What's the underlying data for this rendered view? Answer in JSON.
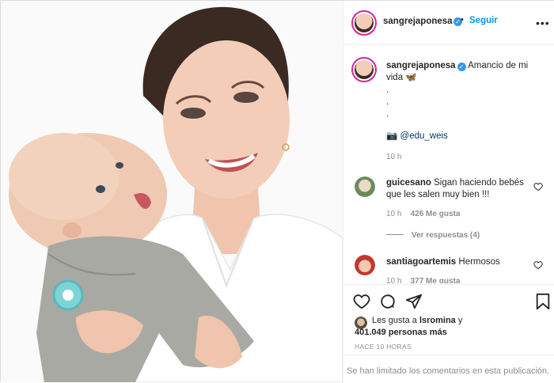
{
  "post": {
    "author": "sangrejaponesa",
    "follow_label": "Seguir",
    "separator": "•",
    "more_icon": "more-horizontal-icon"
  },
  "caption": {
    "username": "sangrejaponesa",
    "text": "Amancio de mi vida 🦋",
    "dots": [
      ".",
      ".",
      "."
    ],
    "camera_emoji": "📷",
    "credit": "@edu_weis",
    "time": "10 h"
  },
  "comments": [
    {
      "username": "guicesano",
      "text": "Sigan haciendo bebés que les salen muy bien !!!",
      "time": "10 h",
      "likes": "426 Me gusta",
      "view_replies": "Ver respuestas (4)"
    },
    {
      "username": "santiagoartemis",
      "text": "Hermosos",
      "time": "10 h",
      "likes": "377 Me gusta"
    }
  ],
  "likes": {
    "prefix": "Les gusta a ",
    "user": "lsromina",
    "conj": " y",
    "count": "401.049 personas más"
  },
  "timestamp": "HACE 10 HORAS",
  "comments_limited": "Se han limitado los comentarios en esta publicación."
}
